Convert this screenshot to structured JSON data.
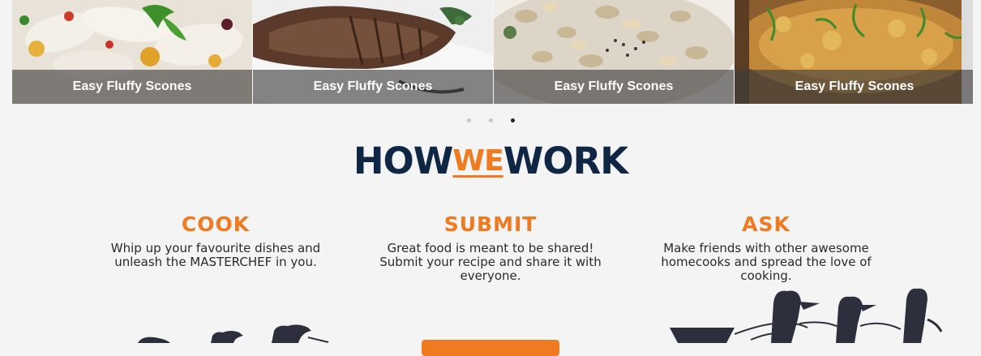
{
  "carousel": {
    "slides": [
      {
        "caption": "Easy Fluffy Scones"
      },
      {
        "caption": "Easy Fluffy Scones"
      },
      {
        "caption": "Easy Fluffy Scones"
      },
      {
        "caption": "Easy Fluffy Scones"
      }
    ],
    "dots": 3,
    "active_dot": 3
  },
  "how_we_work": {
    "how": "HOW",
    "we": "WE",
    "work": "WORK"
  },
  "columns": {
    "cook": {
      "title": "COOK",
      "line1": "Whip up your favourite dishes and",
      "line2": "unleash the MASTERCHEF in you."
    },
    "submit": {
      "title": "SUBMIT",
      "line1": "Great food is meant to be shared!",
      "line2": "Submit your recipe and share it with",
      "line3": "everyone."
    },
    "ask": {
      "title": "ASK",
      "line1": "Make friends with other awesome",
      "line2": "homecooks and spread the love of",
      "line3": "cooking."
    }
  },
  "colors": {
    "accent": "#ef7a1f",
    "heading_navy": "#0f2645",
    "caption_overlay": "rgba(60,60,60,0.62)",
    "silhouette": "#2e2f3d"
  }
}
